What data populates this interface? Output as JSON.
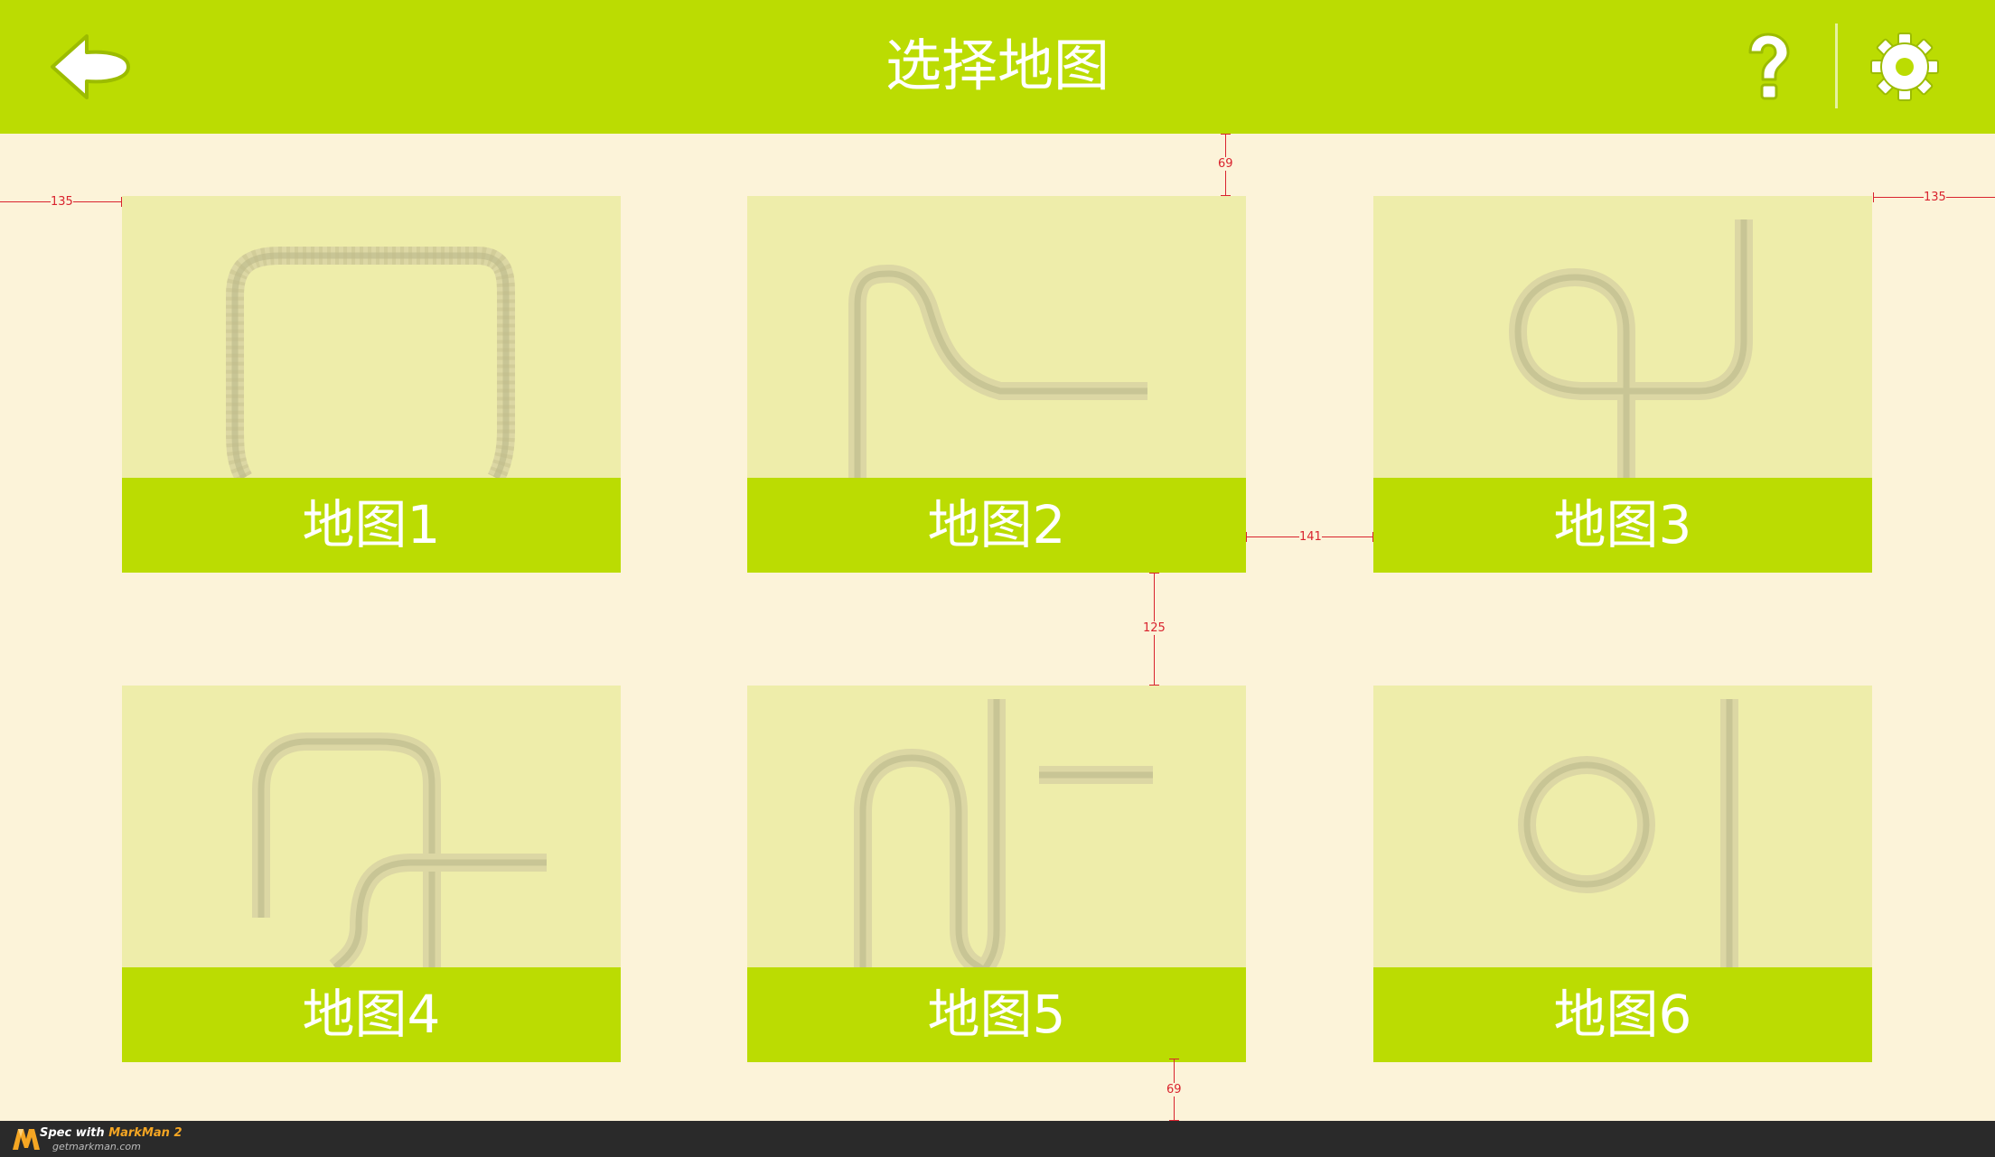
{
  "header": {
    "title": "选择地图",
    "back_icon": "back-arrow-icon",
    "help_icon": "question-mark-icon",
    "settings_icon": "gear-icon",
    "background_color": "#bbdc02"
  },
  "maps": [
    {
      "label": "地图1"
    },
    {
      "label": "地图2"
    },
    {
      "label": "地图3"
    },
    {
      "label": "地图4"
    },
    {
      "label": "地图5"
    },
    {
      "label": "地图6"
    }
  ],
  "spec_dimensions": {
    "top_gap": "69",
    "left_margin": "135",
    "right_margin": "135",
    "column_gap": "141",
    "row_gap": "125",
    "bottom_gap": "69"
  },
  "footer": {
    "line1_prefix": "Spec with ",
    "line1_brand": "MarkMan 2",
    "line2": "getmarkman.com"
  },
  "colors": {
    "accent": "#bbdc02",
    "page_background": "#fcf3d9",
    "card_background": "#eeedaa",
    "track": "#c8c595",
    "spec_line": "#d9232e"
  }
}
